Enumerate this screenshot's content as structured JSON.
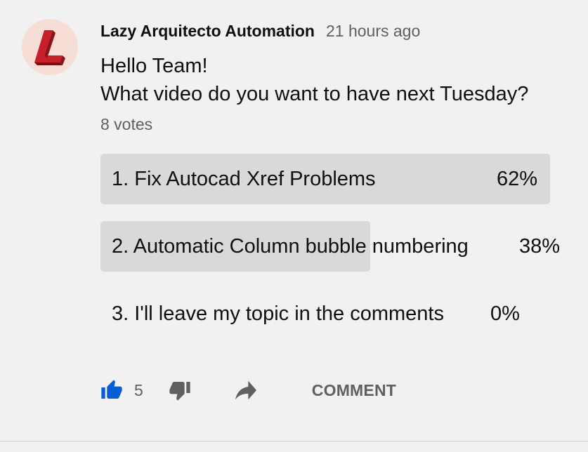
{
  "post": {
    "author": "Lazy Arquitecto Automation",
    "time": "21 hours ago",
    "text_line1": "Hello Team!",
    "text_line2": "What video do you want to have next Tuesday?",
    "votes": "8 votes"
  },
  "poll": {
    "options": [
      {
        "label": "1. Fix Autocad Xref Problems",
        "percent_text": "62%",
        "percent": 62
      },
      {
        "label": "2. Automatic Column bubble numbering",
        "percent_text": "38%",
        "percent": 38
      },
      {
        "label": "3. I'll leave my topic in the comments",
        "percent_text": "0%",
        "percent": 0
      }
    ]
  },
  "actions": {
    "like_count": "5",
    "comment_label": "COMMENT",
    "like_icon": "thumbs-up-icon",
    "dislike_icon": "thumbs-down-icon",
    "share_icon": "share-arrow-icon"
  },
  "colors": {
    "background": "#f1f1f1",
    "poll_fill": "#d9d9d9",
    "like_active": "#065fd4",
    "secondary_text": "#606060",
    "logo_red": "#c8202a"
  }
}
